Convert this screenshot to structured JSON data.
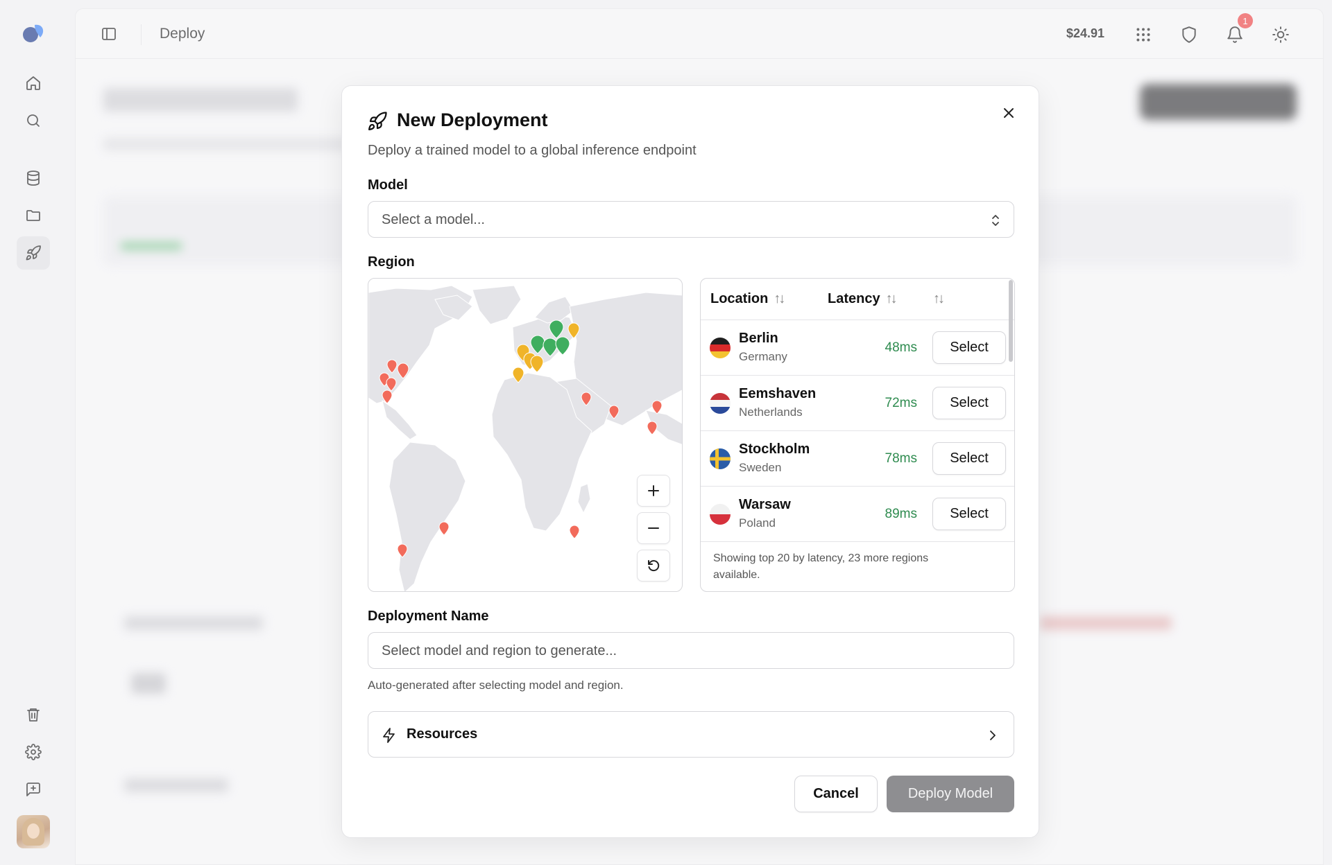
{
  "topbar": {
    "title": "Deploy",
    "credits": "$24.91",
    "notification_count": "1"
  },
  "modal": {
    "title": "New Deployment",
    "description": "Deploy a trained model to a global inference endpoint",
    "model_label": "Model",
    "model_placeholder": "Select a model...",
    "region_label": "Region",
    "table": {
      "col_location": "Location",
      "col_latency": "Latency",
      "rows": [
        {
          "city": "Berlin",
          "country": "Germany",
          "latency": "48ms",
          "action": "Select",
          "flag": "de"
        },
        {
          "city": "Eemshaven",
          "country": "Netherlands",
          "latency": "72ms",
          "action": "Select",
          "flag": "nl"
        },
        {
          "city": "Stockholm",
          "country": "Sweden",
          "latency": "78ms",
          "action": "Select",
          "flag": "se"
        },
        {
          "city": "Warsaw",
          "country": "Poland",
          "latency": "89ms",
          "action": "Select",
          "flag": "pl"
        }
      ],
      "footer": "Showing top 20 by latency, 23 more regions available."
    },
    "deployment_name_label": "Deployment Name",
    "deployment_name_placeholder": "Select model and region to generate...",
    "deployment_name_hint": "Auto-generated after selecting model and region.",
    "resources_label": "Resources",
    "cancel_label": "Cancel",
    "deploy_label": "Deploy Model"
  },
  "colors": {
    "latency_good": "#2e8b4f",
    "pin_green": "#3fae5f",
    "pin_amber": "#f0b429",
    "pin_red": "#f26b5b",
    "badge": "#ef4444",
    "deploy_disabled": "#8e8e91"
  }
}
